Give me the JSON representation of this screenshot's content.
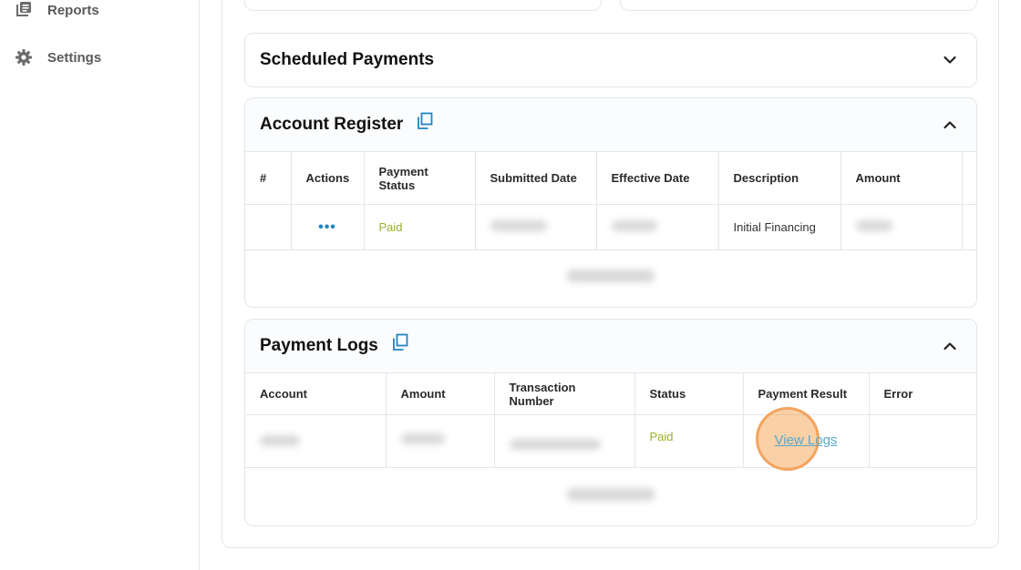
{
  "sidebar": {
    "items": [
      {
        "label": "Reports",
        "icon": "reports-icon"
      },
      {
        "label": "Settings",
        "icon": "gear-icon"
      }
    ]
  },
  "scheduled_payments": {
    "title": "Scheduled Payments",
    "expanded": false
  },
  "account_register": {
    "title": "Account Register",
    "expanded": true,
    "columns": [
      "#",
      "Actions",
      "Payment Status",
      "Submitted Date",
      "Effective Date",
      "Description",
      "Amount"
    ],
    "rows": [
      {
        "number": "",
        "actions": "•••",
        "status": "Paid",
        "description": "Initial Financing"
      }
    ]
  },
  "payment_logs": {
    "title": "Payment Logs",
    "expanded": true,
    "columns": [
      "Account",
      "Amount",
      "Transaction Number",
      "Status",
      "Payment Result",
      "Error"
    ],
    "rows": [
      {
        "status": "Paid",
        "result_link": "View Logs",
        "error": ""
      }
    ]
  },
  "colors": {
    "accent": "#1f86c3",
    "paid": "#9bb02d",
    "click_highlight": "#f0a05a"
  }
}
